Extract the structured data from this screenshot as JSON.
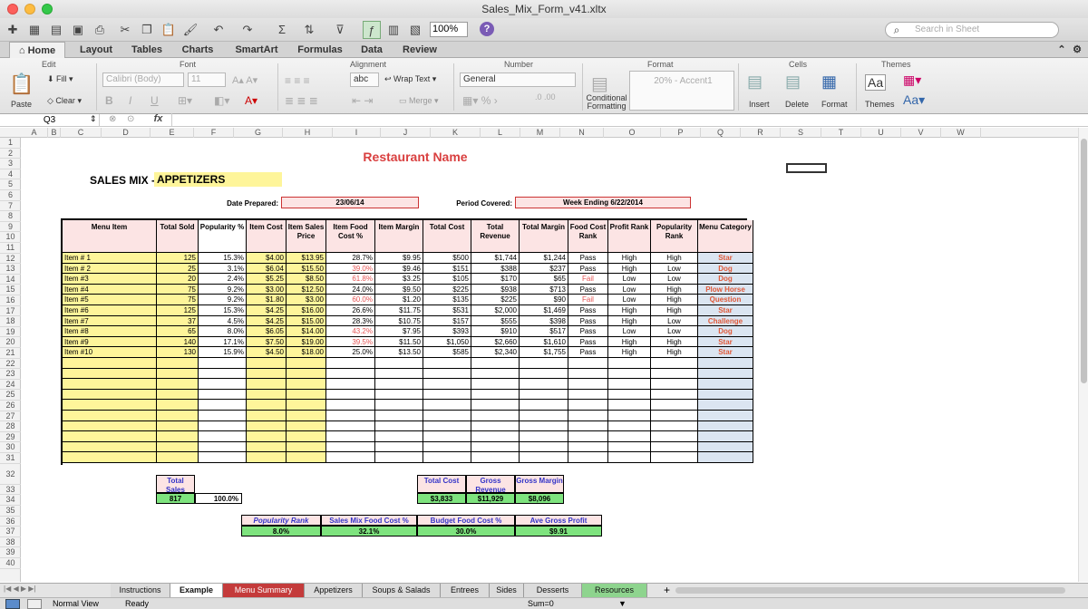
{
  "window": {
    "title": "Sales_Mix_Form_v41.xltx",
    "zoom": "100%",
    "search_placeholder": "Search in Sheet"
  },
  "ribbon_tabs": [
    "Home",
    "Layout",
    "Tables",
    "Charts",
    "SmartArt",
    "Formulas",
    "Data",
    "Review"
  ],
  "ribbon": {
    "groups": [
      "Edit",
      "Font",
      "Alignment",
      "Number",
      "Format",
      "Cells",
      "Themes"
    ],
    "paste": "Paste",
    "fill": "Fill",
    "clear": "Clear",
    "font_name": "Calibri (Body)",
    "font_size": "11",
    "wrap_text": "Wrap Text",
    "merge": "Merge",
    "number_format": "General",
    "style": "20% - Accent1",
    "conditional_formatting": "Conditional Formatting",
    "insert": "Insert",
    "delete": "Delete",
    "format": "Format",
    "themes": "Themes",
    "abc": "abc",
    "bold": "B",
    "italic": "I",
    "underline": "U"
  },
  "formula_bar": {
    "cell": "Q3",
    "fx": "fx",
    "value": ""
  },
  "columns": [
    "A",
    "B",
    "C",
    "D",
    "E",
    "F",
    "G",
    "H",
    "I",
    "J",
    "K",
    "L",
    "M",
    "N",
    "O",
    "P",
    "Q",
    "R",
    "S",
    "T",
    "U",
    "V",
    "W"
  ],
  "rows": [
    "1",
    "2",
    "3",
    "4",
    "5",
    "6",
    "7",
    "8",
    "9",
    "10",
    "11",
    "12",
    "13",
    "14",
    "15",
    "16",
    "17",
    "18",
    "19",
    "20",
    "21",
    "22",
    "23",
    "24",
    "25",
    "26",
    "27",
    "28",
    "29",
    "30",
    "31",
    "32",
    "33",
    "34",
    "35",
    "36",
    "37",
    "38",
    "39",
    "40"
  ],
  "sheet": {
    "restaurant_name": "Restaurant Name",
    "sales_mix_label": "SALES MIX -",
    "category": "APPETIZERS",
    "date_prepared_label": "Date Prepared:",
    "date_prepared": "23/06/14",
    "period_label": "Period Covered:",
    "period": "Week Ending 6/22/2014",
    "headers": [
      "Menu Item",
      "Total Sold",
      "Popularity %",
      "Item Cost",
      "Item Sales Price",
      "Item Food Cost %",
      "Item Margin",
      "Total Cost",
      "Total Revenue",
      "Total Margin",
      "Food Cost Rank",
      "Profit Rank",
      "Popularity Rank",
      "Menu Category"
    ],
    "items": [
      [
        "Item # 1",
        "125",
        "15.3%",
        "$4.00",
        "$13.95",
        "28.7%",
        "$9.95",
        "$500",
        "$1,744",
        "$1,244",
        "Pass",
        "High",
        "High",
        "Star"
      ],
      [
        "Item # 2",
        "25",
        "3.1%",
        "$6.04",
        "$15.50",
        "39.0%",
        "$9.46",
        "$151",
        "$388",
        "$237",
        "Pass",
        "High",
        "Low",
        "Dog"
      ],
      [
        "Item #3",
        "20",
        "2.4%",
        "$5.25",
        "$8.50",
        "61.8%",
        "$3.25",
        "$105",
        "$170",
        "$65",
        "Fail",
        "Low",
        "Low",
        "Dog"
      ],
      [
        "Item #4",
        "75",
        "9.2%",
        "$3.00",
        "$12.50",
        "24.0%",
        "$9.50",
        "$225",
        "$938",
        "$713",
        "Pass",
        "Low",
        "High",
        "Plow Horse"
      ],
      [
        "Item #5",
        "75",
        "9.2%",
        "$1.80",
        "$3.00",
        "60.0%",
        "$1.20",
        "$135",
        "$225",
        "$90",
        "Fail",
        "Low",
        "High",
        "Question"
      ],
      [
        "Item #6",
        "125",
        "15.3%",
        "$4.25",
        "$16.00",
        "26.6%",
        "$11.75",
        "$531",
        "$2,000",
        "$1,469",
        "Pass",
        "High",
        "High",
        "Star"
      ],
      [
        "Item #7",
        "37",
        "4.5%",
        "$4.25",
        "$15.00",
        "28.3%",
        "$10.75",
        "$157",
        "$555",
        "$398",
        "Pass",
        "High",
        "Low",
        "Challenge"
      ],
      [
        "Item #8",
        "65",
        "8.0%",
        "$6.05",
        "$14.00",
        "43.2%",
        "$7.95",
        "$393",
        "$910",
        "$517",
        "Pass",
        "Low",
        "Low",
        "Dog"
      ],
      [
        "Item #9",
        "140",
        "17.1%",
        "$7.50",
        "$19.00",
        "39.5%",
        "$11.50",
        "$1,050",
        "$2,660",
        "$1,610",
        "Pass",
        "High",
        "High",
        "Star"
      ],
      [
        "Item #10",
        "130",
        "15.9%",
        "$4.50",
        "$18.00",
        "25.0%",
        "$13.50",
        "$585",
        "$2,340",
        "$1,755",
        "Pass",
        "High",
        "High",
        "Star"
      ]
    ],
    "totals": {
      "total_sales_label": "Total Sales",
      "total_sales": "817",
      "total_pct": "100.0%",
      "total_cost_label": "Total Cost",
      "total_cost": "$3,833",
      "gross_revenue_label": "Gross Revenue",
      "gross_revenue": "$11,929",
      "gross_margin_label": "Gross Margin",
      "gross_margin": "$8,096"
    },
    "summary": {
      "labels": [
        "Popularity Rank",
        "Sales Mix Food Cost %",
        "Budget Food Cost %",
        "Ave Gross Profit"
      ],
      "values": [
        "8.0%",
        "32.1%",
        "30.0%",
        "$9.91"
      ]
    }
  },
  "sheet_tabs": [
    "Instructions",
    "Example",
    "Menu Summary",
    "Appetizers",
    "Soups & Salads",
    "Entrees",
    "Sides",
    "Desserts",
    "Resources"
  ],
  "status": {
    "view": "Normal View",
    "state": "Ready",
    "sum": "Sum=0"
  },
  "colors": {
    "accent_tab": "#c43b3b",
    "pink": "#fce4e4",
    "yellow": "#fef59a",
    "green": "#7ee37e",
    "blue": "#dbe5f1",
    "red_text": "#e55454",
    "purple_text": "#3434c8"
  }
}
